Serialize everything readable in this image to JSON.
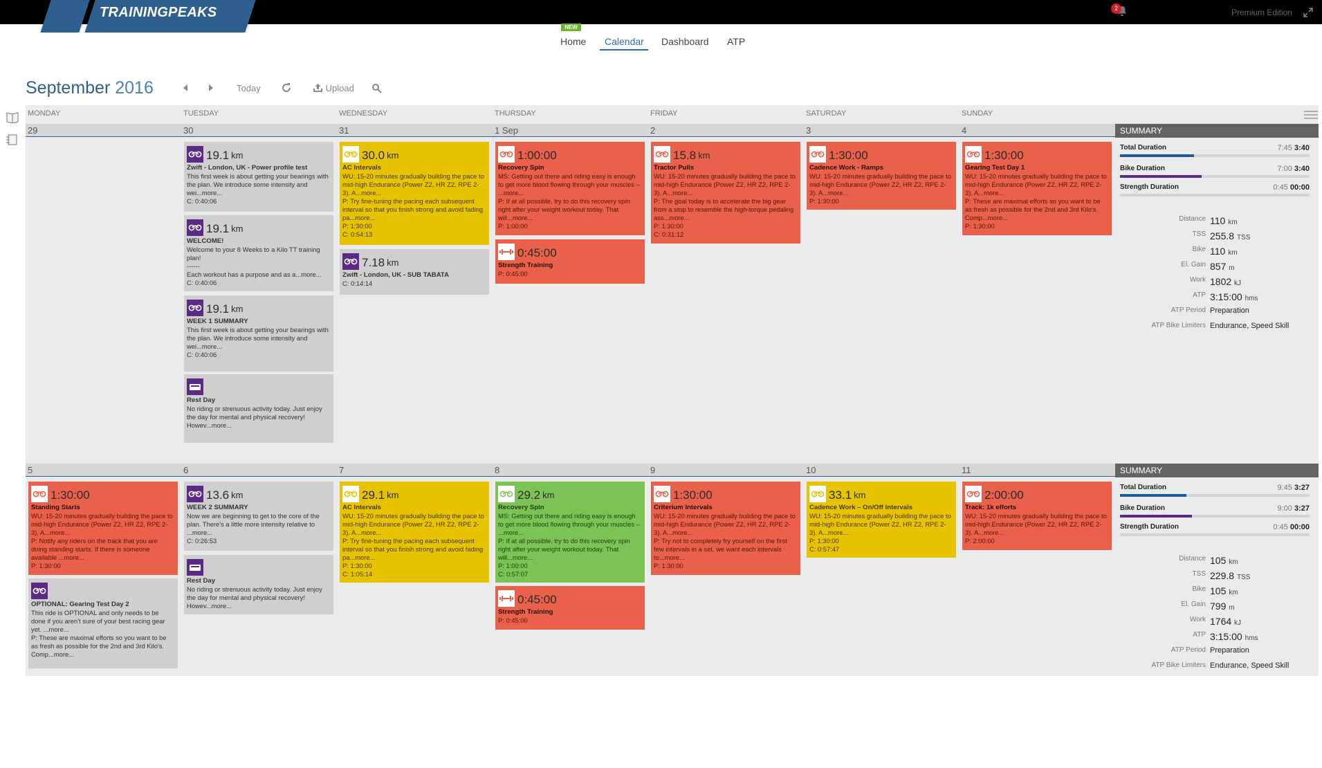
{
  "app": {
    "logo": "TRAININGPEAKS",
    "edition": "Premium Edition",
    "notifications": "2"
  },
  "nav": {
    "new_badge": "NEW",
    "home": "Home",
    "calendar": "Calendar",
    "dashboard": "Dashboard",
    "atp": "ATP"
  },
  "header": {
    "month": "September",
    "year": "2016",
    "today": "Today",
    "upload": "Upload"
  },
  "days": [
    "MONDAY",
    "TUESDAY",
    "WEDNESDAY",
    "THURSDAY",
    "FRIDAY",
    "SATURDAY",
    "SUNDAY"
  ],
  "weeks": [
    {
      "dates": [
        "29",
        "30",
        "31",
        "1 Sep",
        "2",
        "3",
        "4"
      ],
      "summary_label": "SUMMARY",
      "summary": {
        "total": {
          "label": "Total Duration",
          "planned": "7:45",
          "completed": "3:40",
          "fill": 0.39
        },
        "bike": {
          "label": "Bike Duration",
          "planned": "7:00",
          "completed": "3:40",
          "fill": 0.43
        },
        "strength": {
          "label": "Strength Duration",
          "planned": "0:45",
          "completed": "00:00",
          "fill": 0
        },
        "stats": [
          {
            "label": "Distance",
            "value": "110",
            "unit": "km"
          },
          {
            "label": "TSS",
            "value": "255.8",
            "unit": "TSS"
          },
          {
            "label": "Bike",
            "value": "110",
            "unit": "km"
          },
          {
            "label": "El. Gain",
            "value": "857",
            "unit": "m"
          },
          {
            "label": "Work",
            "value": "1802",
            "unit": "kJ"
          },
          {
            "label": "ATP",
            "value": "3:15:00",
            "unit": "hms"
          },
          {
            "label": "ATP Period",
            "value": "Preparation",
            "unit": ""
          },
          {
            "label": "ATP Bike Limiters",
            "value": "Endurance, Speed Skill",
            "unit": ""
          }
        ]
      }
    },
    {
      "dates": [
        "5",
        "6",
        "7",
        "8",
        "9",
        "10",
        "11"
      ],
      "summary_label": "SUMMARY",
      "summary": {
        "total": {
          "label": "Total Duration",
          "planned": "9:45",
          "completed": "3:27",
          "fill": 0.35
        },
        "bike": {
          "label": "Bike Duration",
          "planned": "9:00",
          "completed": "3:27",
          "fill": 0.38
        },
        "strength": {
          "label": "Strength Duration",
          "planned": "0:45",
          "completed": "00:00",
          "fill": 0
        },
        "stats": [
          {
            "label": "Distance",
            "value": "105",
            "unit": "km"
          },
          {
            "label": "TSS",
            "value": "229.8",
            "unit": "TSS"
          },
          {
            "label": "Bike",
            "value": "105",
            "unit": "km"
          },
          {
            "label": "El. Gain",
            "value": "799",
            "unit": "m"
          },
          {
            "label": "Work",
            "value": "1764",
            "unit": "kJ"
          },
          {
            "label": "ATP",
            "value": "3:15:00",
            "unit": "hms"
          },
          {
            "label": "ATP Period",
            "value": "Preparation",
            "unit": ""
          },
          {
            "label": "ATP Bike Limiters",
            "value": "Endurance, Speed Skill",
            "unit": ""
          }
        ]
      }
    }
  ],
  "workouts": [
    {
      "color": "gray",
      "icon": "bike-icon",
      "metric": "19.1",
      "unit": "km",
      "title": "Zwift - London, UK - Power profile test",
      "desc": "This first week is about getting your bearings with the plan. We introduce some intensity and wei...more...",
      "p": "",
      "c": "C: 0:40:06"
    },
    {
      "color": "gray",
      "icon": "bike-icon",
      "metric": "19.1",
      "unit": "km",
      "title": "WELCOME!",
      "desc": "Welcome to your 8 Weeks to a Kilo TT training plan!\n------\nEach workout has a purpose and as a...more...",
      "p": "",
      "c": "C: 0:40:06"
    },
    {
      "color": "gray",
      "icon": "bike-icon",
      "metric": "19.1",
      "unit": "km",
      "title": "WEEK 1 SUMMARY",
      "desc": "This first week is about getting your bearings with the plan. We introduce some intensity and wei...more...",
      "p": "",
      "c": "C: 0:40:06"
    },
    {
      "color": "gray",
      "icon": "rest-icon",
      "metric": "",
      "unit": "",
      "title": "Rest Day",
      "desc": "No riding or strenuous activity today. Just enjoy the day for mental and physical recovery! Howev...more...",
      "p": "",
      "c": ""
    },
    {
      "color": "yellow",
      "icon": "bike-icon",
      "metric": "30.0",
      "unit": "km",
      "title": "AC Intervals",
      "desc": "WU: 15-20 minutes gradually building the pace to mid-high Endurance (Power Z2, HR Z2, RPE 2-3). A...more...",
      "p2": "P: Try fine-tuning the pacing each subsequent interval so that you finish strong and avoid fading pa...more...",
      "p": "P: 1:30:00",
      "c": "C: 0:54:13"
    },
    {
      "color": "gray",
      "icon": "bike-icon",
      "metric": "7.18",
      "unit": "km",
      "title": "Zwift - London, UK - SUB TABATA",
      "desc": "",
      "p": "",
      "c": "C: 0:14:14"
    },
    {
      "color": "red",
      "icon": "bike-icon",
      "metric": "1:00:00",
      "unit": "",
      "title": "Recovery Spin",
      "desc": "MS: Getting out there and riding easy is enough to get more blood flowing through your muscles – ...more...",
      "p2": "P: If at all possible, try to do this recovery spin right after your weight workout today. That will...more...",
      "p": "P: 1:00:00",
      "c": ""
    },
    {
      "color": "red",
      "icon": "strength-icon",
      "metric": "0:45:00",
      "unit": "",
      "title": "Strength Training",
      "desc": "",
      "p": "P: 0:45:00",
      "c": ""
    },
    {
      "color": "red",
      "icon": "bike-icon",
      "metric": "15.8",
      "unit": "km",
      "title": "Tractor Pulls",
      "desc": "WU: 15-20 minutes gradually building the pace to mid-high Endurance (Power Z2, HR Z2, RPE 2-3). A...more...",
      "p2": "P: The goal today is to accelerate the big gear from a stop to resemble the high-torque pedaling ass...more...",
      "p": "P: 1:30:00",
      "c": "C: 0:31:12"
    },
    {
      "color": "red",
      "icon": "bike-icon",
      "metric": "1:30:00",
      "unit": "",
      "title": "Cadence Work - Ramps",
      "desc": "WU: 15-20 minutes gradually building the pace to mid-high Endurance (Power Z2, HR Z2, RPE 2-3). A...more...",
      "p": "P: 1:30:00",
      "c": ""
    },
    {
      "color": "red",
      "icon": "bike-icon",
      "metric": "1:30:00",
      "unit": "",
      "title": "Gearing Test Day 1",
      "desc": "WU: 15-20 minutes gradually building the pace to mid-high Endurance (Power Z2, HR Z2, RPE 2-3). A...more...",
      "p2": "P: These are maximal efforts so you want to be as fresh as possible for the 2nd and 3rd Kilo's. Comp...more...",
      "p": "P: 1:30:00",
      "c": ""
    },
    {
      "color": "red",
      "icon": "bike-icon",
      "metric": "1:30:00",
      "unit": "",
      "title": "Standing Starts",
      "desc": "WU: 15-20 minutes gradually building the pace to mid-high Endurance (Power Z2, HR Z2, RPE 2-3). A...more...",
      "p2": "P: Notify any riders on the track that you are doing standing starts. If there is someone available ...more...",
      "p": "P: 1:30:00",
      "c": ""
    },
    {
      "color": "gray",
      "icon": "bike-icon",
      "metric": "",
      "unit": "",
      "title": "OPTIONAL: Gearing Test Day 2",
      "desc": "This ride is OPTIONAL and only needs to be done if you aren't sure of your best racing gear yet. ...more...",
      "p2": "P: These are maximal efforts so you want to be as fresh as possible for the 2nd and 3rd Kilo's. Comp...more...",
      "p": "",
      "c": ""
    },
    {
      "color": "gray",
      "icon": "bike-icon",
      "metric": "13.6",
      "unit": "km",
      "title": "WEEK 2 SUMMARY",
      "desc": "Now we are beginning to get to the core of the plan. There's a little more intensity relative to ...more...",
      "p": "",
      "c": "C: 0:26:53"
    },
    {
      "color": "gray",
      "icon": "rest-icon",
      "metric": "",
      "unit": "",
      "title": "Rest Day",
      "desc": "No riding or strenuous activity today. Just enjoy the day for mental and physical recovery! Howev...more...",
      "p": "",
      "c": ""
    },
    {
      "color": "yellow",
      "icon": "bike-icon",
      "metric": "29.1",
      "unit": "km",
      "title": "AC Intervals",
      "desc": "WU: 15-20 minutes gradually building the pace to mid-high Endurance (Power Z2, HR Z2, RPE 2-3). A...more...",
      "p2": "P: Try fine-tuning the pacing each subsequent interval so that you finish strong and avoid fading pa...more...",
      "p": "P: 1:30:00",
      "c": "C: 1:05:14"
    },
    {
      "color": "green",
      "icon": "bike-icon",
      "metric": "29.2",
      "unit": "km",
      "title": "Recovery Spin",
      "desc": "MS: Getting out there and riding easy is enough to get more blood flowing through your muscles – ...more...",
      "p2": "P: If at all possible, try to do this recovery spin right after your weight workout today. That will...more...",
      "p": "P: 1:00:00",
      "c": "C: 0:57:07"
    },
    {
      "color": "red",
      "icon": "strength-icon",
      "metric": "0:45:00",
      "unit": "",
      "title": "Strength Training",
      "desc": "",
      "p": "P: 0:45:00",
      "c": ""
    },
    {
      "color": "red",
      "icon": "bike-icon",
      "metric": "1:30:00",
      "unit": "",
      "title": "Criterium Intervals",
      "desc": "WU: 15-20 minutes gradually building the pace to mid-high Endurance (Power Z2, HR Z2, RPE 2-3). A...more...",
      "p2": "P: Try not to completely fry yourself on the first few intervals in a set, we want each intervals to...more...",
      "p": "P: 1:30:00",
      "c": ""
    },
    {
      "color": "yellow",
      "icon": "bike-icon",
      "metric": "33.1",
      "unit": "km",
      "title": "Cadence Work – On/Off Intervals",
      "desc": "WU: 15-20 minutes gradually building the pace to mid-high Endurance (Power Z2, HR Z2, RPE 2-3). A...more...",
      "p": "P: 1:30:00",
      "c": "C: 0:57:47"
    },
    {
      "color": "red",
      "icon": "bike-icon",
      "metric": "2:00:00",
      "unit": "",
      "title": "Track: 1k efforts",
      "desc": "WU: 15-20 minutes gradually building the pace to mid-high Endurance (Power Z2, HR Z2, RPE 2-3). A...more...",
      "p": "P: 2:00:00",
      "c": ""
    }
  ]
}
